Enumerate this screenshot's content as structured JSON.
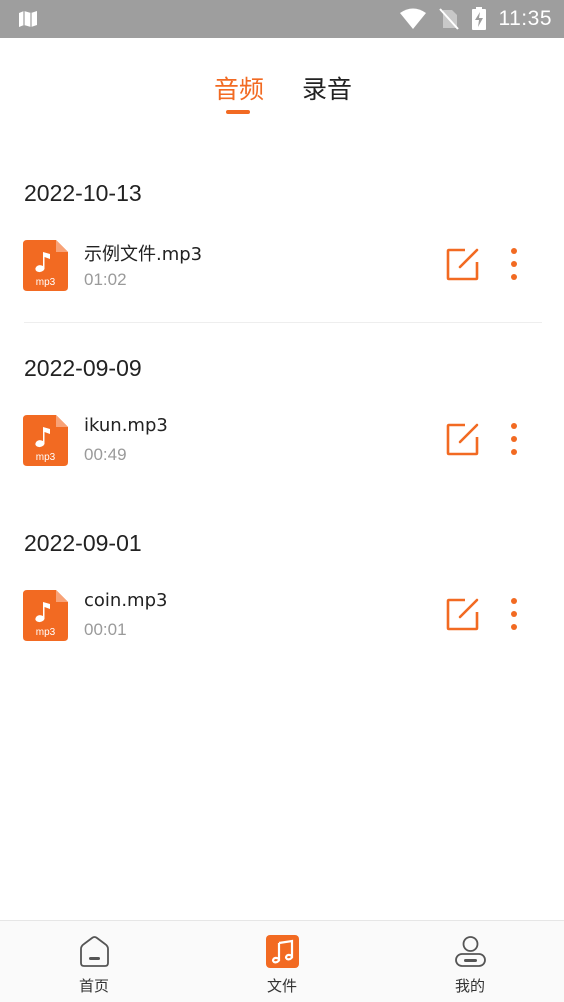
{
  "status_bar": {
    "time": "11:35",
    "icons": [
      "map-icon",
      "wifi-icon",
      "no-sim-icon",
      "battery-charging-icon"
    ],
    "background": "#9e9e9e"
  },
  "tabs": [
    {
      "label": "音频",
      "active": true
    },
    {
      "label": "录音",
      "active": false
    }
  ],
  "accent_color": "#f26a22",
  "groups": [
    {
      "date": "2022-10-13",
      "files": [
        {
          "name": "示例文件.mp3",
          "duration": "01:02",
          "icon_label": "mp3"
        }
      ]
    },
    {
      "date": "2022-09-09",
      "files": [
        {
          "name": "ikun.mp3",
          "duration": "00:49",
          "icon_label": "mp3"
        }
      ]
    },
    {
      "date": "2022-09-01",
      "files": [
        {
          "name": "coin.mp3",
          "duration": "00:01",
          "icon_label": "mp3"
        }
      ]
    }
  ],
  "row_actions": {
    "edit_icon": "edit-icon",
    "more_icon": "more-vertical-icon"
  },
  "bottom_nav": [
    {
      "label": "首页",
      "icon": "home-icon",
      "active": false
    },
    {
      "label": "文件",
      "icon": "music-file-icon",
      "active": true
    },
    {
      "label": "我的",
      "icon": "user-icon",
      "active": false
    }
  ]
}
